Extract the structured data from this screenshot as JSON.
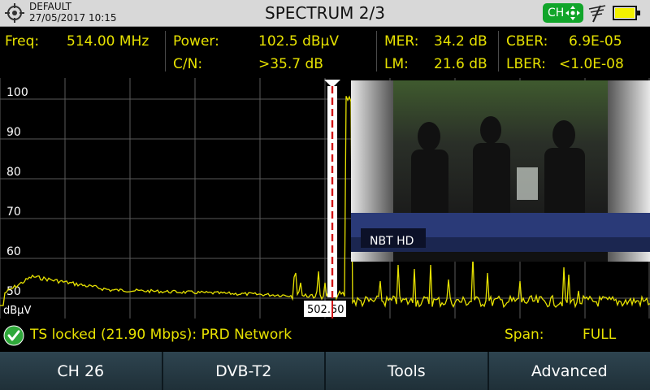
{
  "header": {
    "profile": "DEFAULT",
    "datetime": "27/05/2017 10:15",
    "title": "SPECTRUM 2/3",
    "channel_badge": "CH"
  },
  "measurements": {
    "freq": {
      "label": "Freq:",
      "value": "514.00 MHz"
    },
    "power": {
      "label": "Power:",
      "value": "102.5 dBµV"
    },
    "cn": {
      "label": "C/N:",
      "value": ">35.7 dB"
    },
    "mer": {
      "label": "MER:",
      "value": "34.2 dB"
    },
    "lm": {
      "label": "LM:",
      "value": "21.6 dB"
    },
    "cber": {
      "label": "CBER:",
      "value": "6.9E-05"
    },
    "lber": {
      "label": "LBER:",
      "value": "<1.0E-08"
    }
  },
  "spectrum": {
    "y_ticks": [
      "100",
      "90",
      "80",
      "70",
      "60",
      "50"
    ],
    "unit": "dBµV",
    "marker_label": "502.50",
    "preview_caption": "NBT HD",
    "colors": {
      "trace": "#e7e200",
      "grid": "#5a5a5a",
      "marker": "#d21414"
    }
  },
  "status": {
    "text": "TS locked (21.90 Mbps): PRD Network",
    "span_label": "Span:",
    "span_value": "FULL"
  },
  "softkeys": [
    "CH 26",
    "DVB-T2",
    "Tools",
    "Advanced"
  ]
}
